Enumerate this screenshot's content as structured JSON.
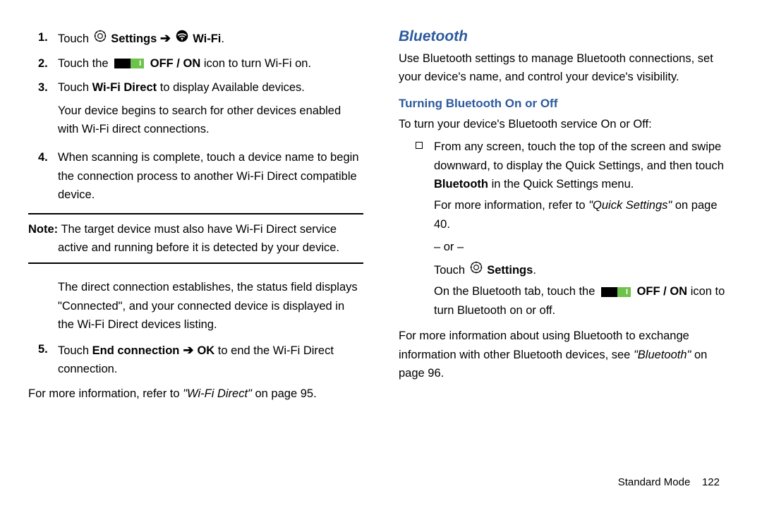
{
  "left": {
    "steps": [
      {
        "num": "1.",
        "parts": [
          "Touch ",
          "GEAR",
          " ",
          "Settings",
          " ",
          "ARROW",
          " ",
          "WIFI",
          " ",
          "Wi-Fi",
          "."
        ]
      },
      {
        "num": "2.",
        "parts": [
          "Touch the ",
          "TOGGLE",
          " ",
          "OFF / ON",
          " icon to turn Wi-Fi on."
        ]
      },
      {
        "num": "3.",
        "parts": [
          "Touch ",
          "Wi-Fi Direct",
          " to display Available devices."
        ],
        "after": "Your device begins to search for other devices enabled with Wi-Fi direct connections."
      },
      {
        "num": "4.",
        "parts": [
          "When scanning is complete, touch a device name to begin the connection process to another Wi-Fi Direct compatible device."
        ]
      }
    ],
    "note_label": "Note:",
    "note_line1": " The target device must also have Wi-Fi Direct service",
    "note_line2": "active and running before it is detected by your device.",
    "post_note_para": "The direct connection establishes, the status field displays \"Connected\", and your connected device is displayed in the Wi-Fi Direct devices listing.",
    "step5": {
      "num": "5.",
      "pre": "Touch ",
      "bold1": "End connection",
      "arrow": " ➔ ",
      "bold2": "OK",
      "post": " to end the Wi-Fi Direct connection."
    },
    "more_info_pre": "For more information, refer to ",
    "more_info_ital": "\"Wi-Fi Direct\"",
    "more_info_post": " on page 95."
  },
  "right": {
    "h1": "Bluetooth",
    "intro": "Use Bluetooth settings to manage Bluetooth connections, set your device's name, and control your device's visibility.",
    "h2": "Turning Bluetooth On or Off",
    "lead": "To turn your device's Bluetooth service On or Off:",
    "bullet_p1_pre": "From any screen, touch the top of the screen and swipe downward, to display the Quick Settings, and then touch ",
    "bullet_p1_bold": "Bluetooth",
    "bullet_p1_post": " in the Quick Settings menu.",
    "bullet_p2_pre": "For more information, refer to ",
    "bullet_p2_ital": "\"Quick Settings\"",
    "bullet_p2_post": " on page 40.",
    "or": "– or –",
    "touch_pre": "Touch ",
    "touch_bold": "Settings",
    "touch_post": ".",
    "bt_tab_pre": "On the Bluetooth tab, touch the ",
    "bt_tab_bold": "OFF / ON",
    "bt_tab_post": " icon to turn Bluetooth on or off.",
    "more_pre": "For more information about using Bluetooth to exchange information with other Bluetooth devices, see ",
    "more_ital": "\"Bluetooth\"",
    "more_post": " on page 96."
  },
  "footer": {
    "mode": "Standard Mode",
    "page": "122"
  }
}
